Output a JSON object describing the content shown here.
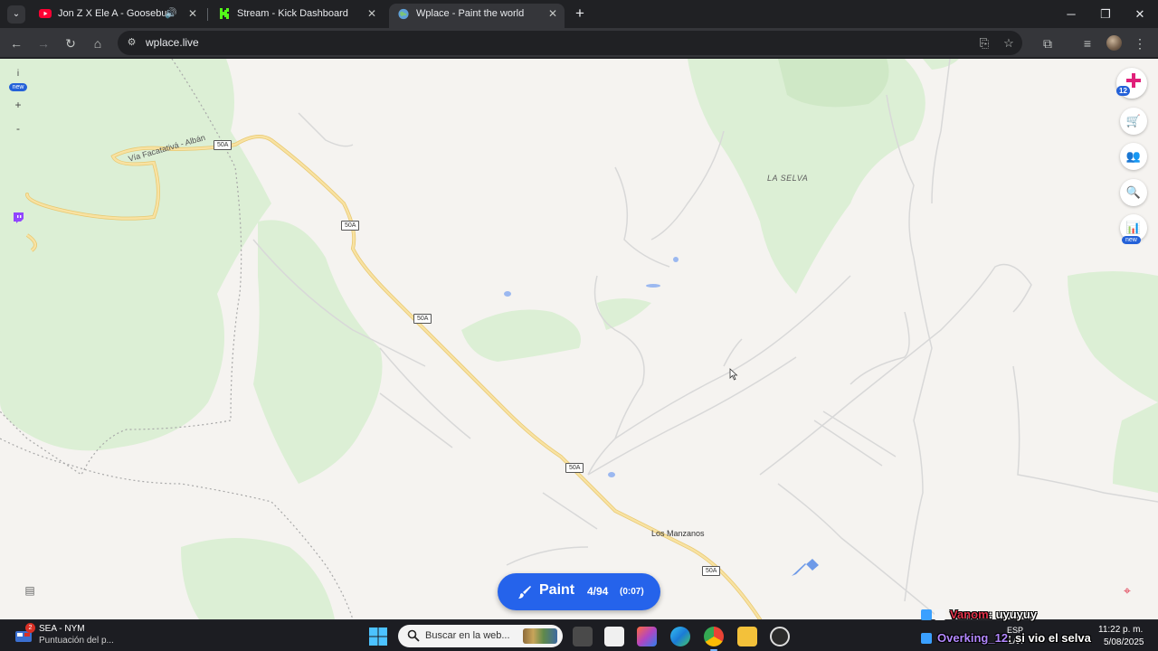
{
  "browser": {
    "tabs": [
      {
        "title": "Jon Z X Ele A - Goosebump",
        "icon": "youtube-icon",
        "audio": true,
        "active": false
      },
      {
        "title": "Stream - Kick Dashboard",
        "icon": "kick-icon",
        "audio": false,
        "active": false
      },
      {
        "title": "Wplace - Paint the world",
        "icon": "globe-icon",
        "audio": false,
        "active": true
      }
    ],
    "url": "wplace.live"
  },
  "map": {
    "area_labels": [
      "LA SELVA"
    ],
    "town_labels": [
      "Los Manzanos"
    ],
    "road_shields": [
      "50A",
      "50A",
      "50A",
      "50A",
      "50A"
    ],
    "road_names": [
      "Vía Facatativá - Albán"
    ],
    "left_controls": {
      "info": "i",
      "info_badge": "new",
      "zoom_in": "+",
      "zoom_out": "-"
    },
    "right_controls": {
      "pixel_count": "12",
      "leaderboard_badge": "new"
    }
  },
  "paint_button": {
    "label": "Paint",
    "count": "4/94",
    "timer": "(0:07)"
  },
  "taskbar": {
    "weather_title": "SEA - NYM",
    "weather_subtitle": "Puntuación del p...",
    "weather_badge": "2",
    "search_placeholder": "Buscar en la web...",
    "language": "ESP",
    "language_sub": "LAA",
    "time": "11:22 p. m.",
    "date": "5/08/2025"
  },
  "stream_chat": [
    {
      "user": "Vanom",
      "message": ": uyuyuy",
      "user_color": "#e0334a"
    },
    {
      "user": "Overking_12",
      "message": ": si vio el selva",
      "user_color": "#b388ff"
    }
  ],
  "colors": {
    "accent": "#2563eb",
    "map_background": "#f5f3f0",
    "forest": "#dcefd5",
    "road_major": "#f6d98a",
    "water": "#9bb8f0"
  }
}
